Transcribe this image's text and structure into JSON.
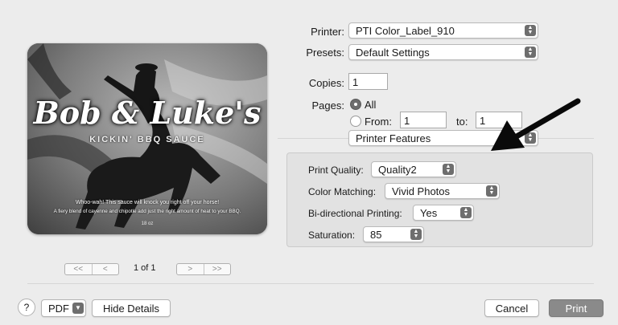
{
  "preview": {
    "brand": "Bob & Luke's",
    "subtitle": "KICKIN' BBQ SAUCE",
    "tagline1": "Whoo-wah! This sauce will knock you right off your horse!",
    "tagline2": "A fiery blend of cayenne and chipotle add just the right amount of heat to your BBQ.",
    "size": "18 oz"
  },
  "pagination": {
    "first": "<<",
    "prev": "<",
    "next": ">",
    "last": ">>",
    "label": "1 of 1"
  },
  "printer": {
    "label": "Printer:",
    "value": "PTI Color_Label_910"
  },
  "presets": {
    "label": "Presets:",
    "value": "Default Settings"
  },
  "copies": {
    "label": "Copies:",
    "value": "1"
  },
  "pages": {
    "label": "Pages:",
    "all": "All",
    "from_label": "From:",
    "from_value": "1",
    "to_label": "to:",
    "to_value": "1"
  },
  "section": {
    "value": "Printer Features"
  },
  "features": {
    "print_quality": {
      "label": "Print Quality:",
      "value": "Quality2"
    },
    "color_matching": {
      "label": "Color Matching:",
      "value": "Vivid Photos"
    },
    "bidirectional": {
      "label": "Bi-directional Printing:",
      "value": "Yes"
    },
    "saturation": {
      "label": "Saturation:",
      "value": "85"
    }
  },
  "footer": {
    "help": "?",
    "pdf": "PDF",
    "hide_details": "Hide Details",
    "cancel": "Cancel",
    "print": "Print"
  }
}
